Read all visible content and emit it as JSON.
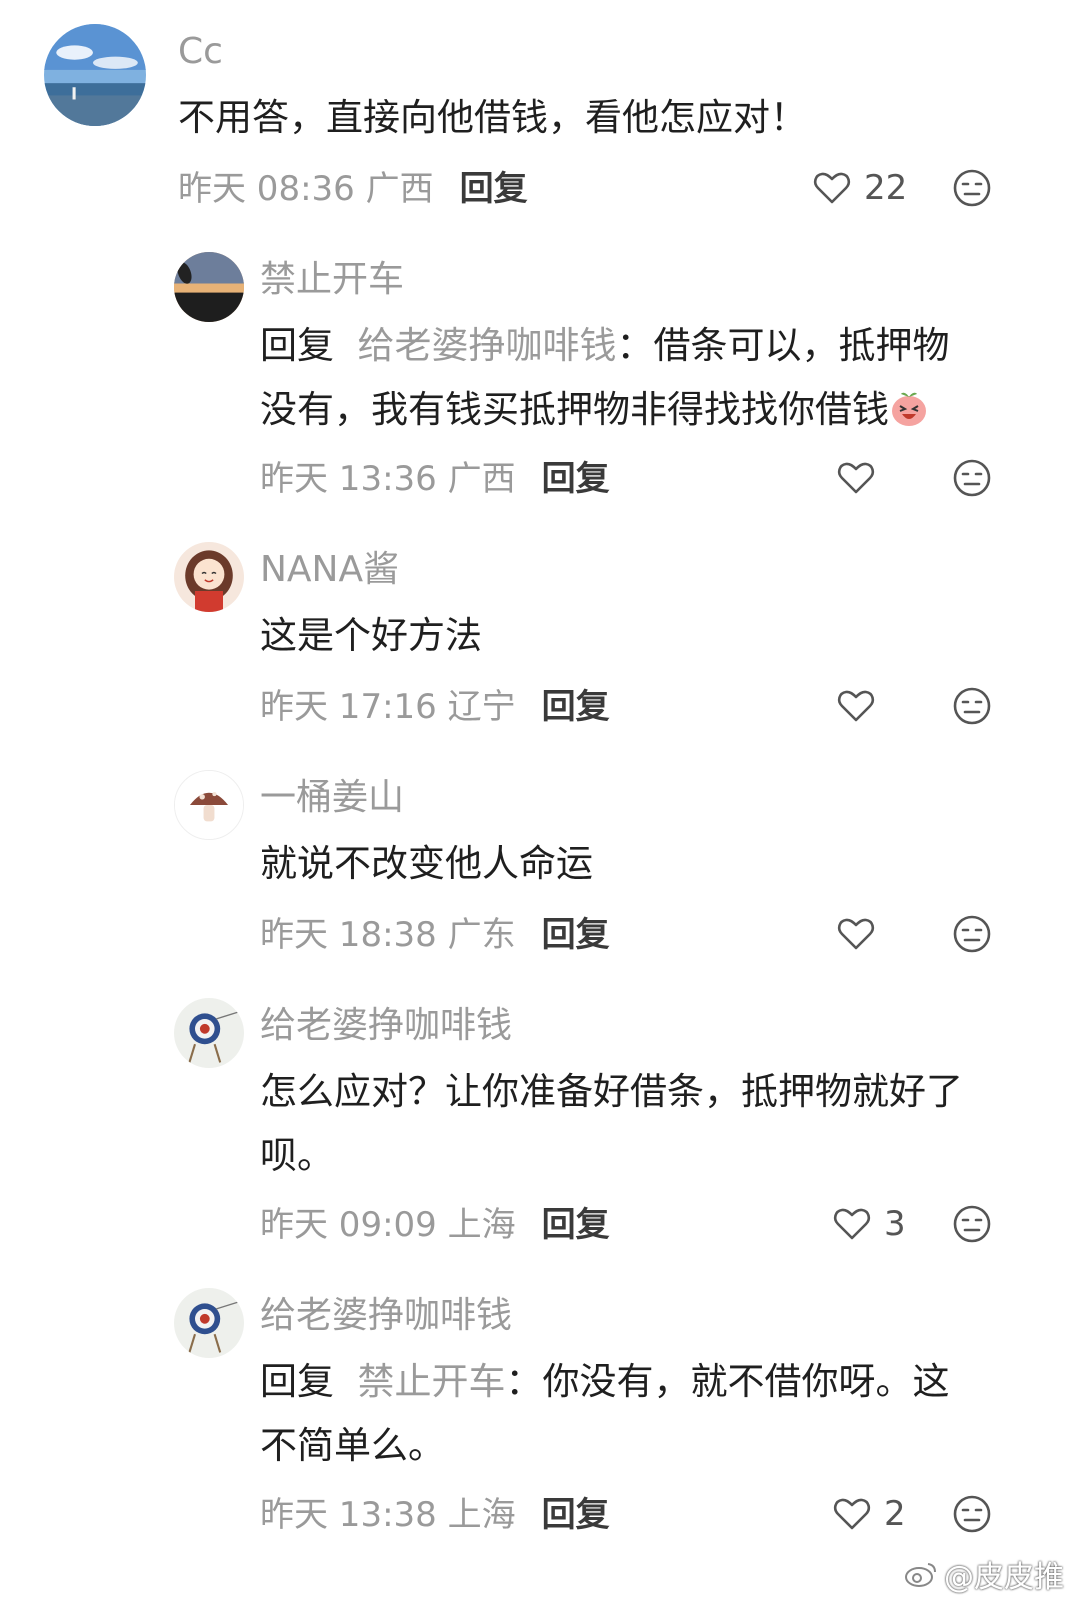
{
  "comments": [
    {
      "name": "Cc",
      "text": "不用答，直接向他借钱，看他怎应对！",
      "time": "昨天 08:36 广西",
      "reply_label": "回复",
      "likes": "22"
    },
    {
      "name": "禁止开车",
      "reply_prefix": "回复",
      "reply_target": "给老婆挣咖啡钱",
      "text_line1": "：借条可以，抵押物",
      "text_line2": "没有，我有钱买抵押物非得找找你借钱",
      "time": "昨天 13:36 广西",
      "reply_label": "回复",
      "likes": ""
    },
    {
      "name": "NANA酱",
      "text": "这是个好方法",
      "time": "昨天 17:16 辽宁",
      "reply_label": "回复",
      "likes": ""
    },
    {
      "name": "一桶姜山",
      "text": "就说不改变他人命运",
      "time": "昨天 18:38 广东",
      "reply_label": "回复",
      "likes": ""
    },
    {
      "name": "给老婆挣咖啡钱",
      "text_line1": "怎么应对？让你准备好借条，抵押物就好了",
      "text_line2": "呗。",
      "time": "昨天 09:09 上海",
      "reply_label": "回复",
      "likes": "3"
    },
    {
      "name": "给老婆挣咖啡钱",
      "reply_prefix": "回复",
      "reply_target": "禁止开车",
      "text_line1": "：你没有，就不借你呀。这",
      "text_line2": "不简单么。",
      "time": "昨天 13:38 上海",
      "reply_label": "回复",
      "likes": "2"
    }
  ],
  "icons": {
    "like": "heart-outline-icon",
    "dislike": "neutral-face-icon",
    "inline_emoji": "laughing-peach-emoji"
  },
  "watermark": "@皮皮推"
}
